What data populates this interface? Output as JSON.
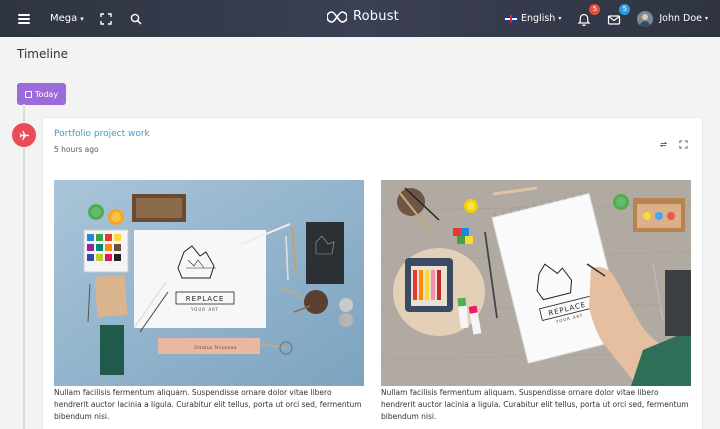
{
  "navbar": {
    "mega_label": "Mega",
    "brand": "Robust",
    "language": "English",
    "notifications_count": "5",
    "messages_count": "5",
    "user_name": "John Doe",
    "icons": [
      "menu-icon",
      "expand-icon",
      "search-icon",
      "bell-icon",
      "mail-icon"
    ]
  },
  "page": {
    "title": "Timeline",
    "today_button": "Today"
  },
  "timeline": {
    "items": [
      {
        "title": "Portfolio project work",
        "time": "5 hours ago",
        "marker_icon": "airplane-icon",
        "marker_color": "#ea4b55",
        "images": [
          {
            "caption": "Nullam facilisis fermentum aliquam. Suspendisse ornare dolor vitae libero hendrerit auctor lacinia a ligula. Curabitur elit tellus, porta ut orci sed, fermentum bibendum nisi."
          },
          {
            "caption": "Nullam facilisis fermentum aliquam. Suspendisse ornare dolor vitae libero hendrerit auctor lacinia a ligula. Curabitur elit tellus, porta ut orci sed, fermentum bibendum nisi."
          }
        ]
      }
    ]
  },
  "colors": {
    "accent": "#9b6bd8",
    "link": "#3ba0c3",
    "marker": "#ea4b55",
    "navbar": "#2f3442"
  }
}
